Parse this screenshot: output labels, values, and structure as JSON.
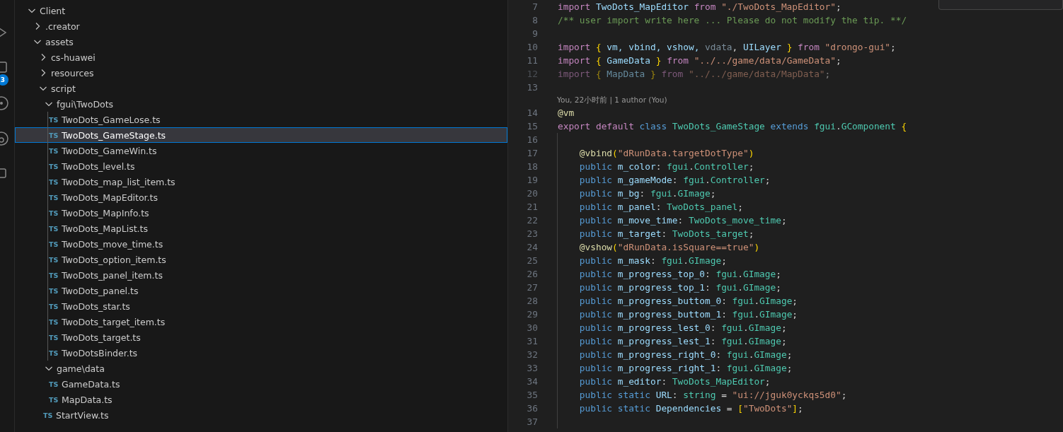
{
  "activity_bar": {
    "badge": "3"
  },
  "explorer": {
    "tree": [
      {
        "label": "Client",
        "kind": "folder",
        "expanded": true,
        "selected": false,
        "children": [
          {
            "label": ".creator",
            "kind": "folder",
            "expanded": false,
            "selected": false
          },
          {
            "label": "assets",
            "kind": "folder",
            "expanded": true,
            "selected": false,
            "children": [
              {
                "label": "cs-huawei",
                "kind": "folder",
                "expanded": false,
                "selected": false
              },
              {
                "label": "resources",
                "kind": "folder",
                "expanded": false,
                "selected": false
              },
              {
                "label": "script",
                "kind": "folder",
                "expanded": true,
                "selected": false,
                "children": [
                  {
                    "label": "fgui\\TwoDots",
                    "kind": "folder",
                    "expanded": true,
                    "selected": false,
                    "children": [
                      {
                        "label": "TwoDots_GameLose.ts",
                        "kind": "file",
                        "icon": "TS",
                        "selected": false
                      },
                      {
                        "label": "TwoDots_GameStage.ts",
                        "kind": "file",
                        "icon": "TS",
                        "selected": true
                      },
                      {
                        "label": "TwoDots_GameWin.ts",
                        "kind": "file",
                        "icon": "TS",
                        "selected": false
                      },
                      {
                        "label": "TwoDots_level.ts",
                        "kind": "file",
                        "icon": "TS",
                        "selected": false
                      },
                      {
                        "label": "TwoDots_map_list_item.ts",
                        "kind": "file",
                        "icon": "TS",
                        "selected": false
                      },
                      {
                        "label": "TwoDots_MapEditor.ts",
                        "kind": "file",
                        "icon": "TS",
                        "selected": false
                      },
                      {
                        "label": "TwoDots_MapInfo.ts",
                        "kind": "file",
                        "icon": "TS",
                        "selected": false
                      },
                      {
                        "label": "TwoDots_MapList.ts",
                        "kind": "file",
                        "icon": "TS",
                        "selected": false
                      },
                      {
                        "label": "TwoDots_move_time.ts",
                        "kind": "file",
                        "icon": "TS",
                        "selected": false
                      },
                      {
                        "label": "TwoDots_option_item.ts",
                        "kind": "file",
                        "icon": "TS",
                        "selected": false
                      },
                      {
                        "label": "TwoDots_panel_item.ts",
                        "kind": "file",
                        "icon": "TS",
                        "selected": false
                      },
                      {
                        "label": "TwoDots_panel.ts",
                        "kind": "file",
                        "icon": "TS",
                        "selected": false
                      },
                      {
                        "label": "TwoDots_star.ts",
                        "kind": "file",
                        "icon": "TS",
                        "selected": false
                      },
                      {
                        "label": "TwoDots_target_item.ts",
                        "kind": "file",
                        "icon": "TS",
                        "selected": false
                      },
                      {
                        "label": "TwoDots_target.ts",
                        "kind": "file",
                        "icon": "TS",
                        "selected": false
                      },
                      {
                        "label": "TwoDotsBinder.ts",
                        "kind": "file",
                        "icon": "TS",
                        "selected": false
                      }
                    ]
                  },
                  {
                    "label": "game\\data",
                    "kind": "folder",
                    "expanded": true,
                    "selected": false,
                    "children": [
                      {
                        "label": "GameData.ts",
                        "kind": "file",
                        "icon": "TS",
                        "selected": false
                      },
                      {
                        "label": "MapData.ts",
                        "kind": "file",
                        "icon": "TS",
                        "selected": false
                      }
                    ]
                  },
                  {
                    "label": "StartView.ts",
                    "kind": "file",
                    "icon": "TS",
                    "selected": false
                  }
                ]
              }
            ]
          }
        ]
      }
    ]
  },
  "editor": {
    "lines": [
      {
        "number": "7",
        "tokens": [
          {
            "kind": "keyword",
            "text": "import "
          },
          {
            "kind": "variable",
            "text": "TwoDots_MapEditor "
          },
          {
            "kind": "keyword",
            "text": "from "
          },
          {
            "kind": "string",
            "text": "\"./TwoDots_MapEditor\""
          },
          {
            "kind": "plain",
            "text": ";"
          }
        ]
      },
      {
        "number": "8",
        "tokens": [
          {
            "kind": "comment",
            "text": "/** user import write here ... Please do not modify the tip. **/"
          }
        ]
      },
      {
        "number": "9"
      },
      {
        "number": "10",
        "tokens": [
          {
            "kind": "keyword",
            "text": "import "
          },
          {
            "kind": "brace",
            "text": "{"
          },
          {
            "kind": "variable",
            "text": " vm, vbind, vshow, "
          },
          {
            "kind": "unused",
            "text": "vdata"
          },
          {
            "kind": "plain",
            "text": ", "
          },
          {
            "kind": "variable",
            "text": "UILayer "
          },
          {
            "kind": "brace",
            "text": "}"
          },
          {
            "kind": "keyword",
            "text": " from "
          },
          {
            "kind": "string",
            "text": "\"drongo-gui\""
          },
          {
            "kind": "plain",
            "text": ";"
          }
        ]
      },
      {
        "number": "11",
        "tokens": [
          {
            "kind": "keyword",
            "text": "import "
          },
          {
            "kind": "brace",
            "text": "{"
          },
          {
            "kind": "variable",
            "text": " GameData "
          },
          {
            "kind": "brace",
            "text": "}"
          },
          {
            "kind": "keyword",
            "text": " from "
          },
          {
            "kind": "string",
            "text": "\"../../game/data/GameData\""
          },
          {
            "kind": "plain",
            "text": ";"
          }
        ]
      },
      {
        "number": "12",
        "faded": true,
        "tokens": [
          {
            "kind": "keyword",
            "text": "import "
          },
          {
            "kind": "brace",
            "text": "{"
          },
          {
            "kind": "variable",
            "text": " MapData "
          },
          {
            "kind": "brace",
            "text": "}"
          },
          {
            "kind": "keyword",
            "text": " from "
          },
          {
            "kind": "string",
            "text": "\"../../game/data/MapData\""
          },
          {
            "kind": "plain",
            "text": ";"
          }
        ]
      },
      {
        "number": "13"
      },
      {
        "number": "14",
        "codelens": "You, 22小时前 | 1 author (You)",
        "tokens": [
          {
            "kind": "decorator",
            "text": "@vm"
          }
        ]
      },
      {
        "number": "15",
        "tokens": [
          {
            "kind": "keyword",
            "text": "export default "
          },
          {
            "kind": "storage",
            "text": "class "
          },
          {
            "kind": "type",
            "text": "TwoDots_GameStage "
          },
          {
            "kind": "storage",
            "text": "extends "
          },
          {
            "kind": "type",
            "text": "fgui"
          },
          {
            "kind": "plain",
            "text": "."
          },
          {
            "kind": "type",
            "text": "GComponent "
          },
          {
            "kind": "brace",
            "text": "{"
          }
        ]
      },
      {
        "number": "16",
        "guide": true
      },
      {
        "number": "17",
        "guide": true,
        "tokens": [
          {
            "kind": "decorator",
            "text": "    @vbind"
          },
          {
            "kind": "brace",
            "text": "("
          },
          {
            "kind": "string",
            "text": "\"dRunData.targetDotType\""
          },
          {
            "kind": "brace",
            "text": ")"
          }
        ]
      },
      {
        "number": "18",
        "guide": true,
        "tokens": [
          {
            "kind": "storage",
            "text": "    public"
          },
          {
            "kind": "variable",
            "text": " m_color"
          },
          {
            "kind": "plain",
            "text": ": "
          },
          {
            "kind": "type",
            "text": "fgui"
          },
          {
            "kind": "plain",
            "text": "."
          },
          {
            "kind": "type",
            "text": "Controller"
          },
          {
            "kind": "plain",
            "text": ";"
          }
        ]
      },
      {
        "number": "19",
        "guide": true,
        "tokens": [
          {
            "kind": "storage",
            "text": "    public"
          },
          {
            "kind": "variable",
            "text": " m_gameMode"
          },
          {
            "kind": "plain",
            "text": ": "
          },
          {
            "kind": "type",
            "text": "fgui"
          },
          {
            "kind": "plain",
            "text": "."
          },
          {
            "kind": "type",
            "text": "Controller"
          },
          {
            "kind": "plain",
            "text": ";"
          }
        ]
      },
      {
        "number": "20",
        "guide": true,
        "tokens": [
          {
            "kind": "storage",
            "text": "    public"
          },
          {
            "kind": "variable",
            "text": " m_bg"
          },
          {
            "kind": "plain",
            "text": ": "
          },
          {
            "kind": "type",
            "text": "fgui"
          },
          {
            "kind": "plain",
            "text": "."
          },
          {
            "kind": "type",
            "text": "GImage"
          },
          {
            "kind": "plain",
            "text": ";"
          }
        ]
      },
      {
        "number": "21",
        "guide": true,
        "tokens": [
          {
            "kind": "storage",
            "text": "    public"
          },
          {
            "kind": "variable",
            "text": " m_panel"
          },
          {
            "kind": "plain",
            "text": ": "
          },
          {
            "kind": "type",
            "text": "TwoDots_panel"
          },
          {
            "kind": "plain",
            "text": ";"
          }
        ]
      },
      {
        "number": "22",
        "guide": true,
        "tokens": [
          {
            "kind": "storage",
            "text": "    public"
          },
          {
            "kind": "variable",
            "text": " m_move_time"
          },
          {
            "kind": "plain",
            "text": ": "
          },
          {
            "kind": "type",
            "text": "TwoDots_move_time"
          },
          {
            "kind": "plain",
            "text": ";"
          }
        ]
      },
      {
        "number": "23",
        "guide": true,
        "tokens": [
          {
            "kind": "storage",
            "text": "    public"
          },
          {
            "kind": "variable",
            "text": " m_target"
          },
          {
            "kind": "plain",
            "text": ": "
          },
          {
            "kind": "type",
            "text": "TwoDots_target"
          },
          {
            "kind": "plain",
            "text": ";"
          }
        ]
      },
      {
        "number": "24",
        "guide": true,
        "tokens": [
          {
            "kind": "decorator",
            "text": "    @vshow"
          },
          {
            "kind": "brace",
            "text": "("
          },
          {
            "kind": "string",
            "text": "\"dRunData.isSquare==true\""
          },
          {
            "kind": "brace",
            "text": ")"
          }
        ]
      },
      {
        "number": "25",
        "guide": true,
        "tokens": [
          {
            "kind": "storage",
            "text": "    public"
          },
          {
            "kind": "variable",
            "text": " m_mask"
          },
          {
            "kind": "plain",
            "text": ": "
          },
          {
            "kind": "type",
            "text": "fgui"
          },
          {
            "kind": "plain",
            "text": "."
          },
          {
            "kind": "type",
            "text": "GImage"
          },
          {
            "kind": "plain",
            "text": ";"
          }
        ]
      },
      {
        "number": "26",
        "guide": true,
        "tokens": [
          {
            "kind": "storage",
            "text": "    public"
          },
          {
            "kind": "variable",
            "text": " m_progress_top_0"
          },
          {
            "kind": "plain",
            "text": ": "
          },
          {
            "kind": "type",
            "text": "fgui"
          },
          {
            "kind": "plain",
            "text": "."
          },
          {
            "kind": "type",
            "text": "GImage"
          },
          {
            "kind": "plain",
            "text": ";"
          }
        ]
      },
      {
        "number": "27",
        "guide": true,
        "tokens": [
          {
            "kind": "storage",
            "text": "    public"
          },
          {
            "kind": "variable",
            "text": " m_progress_top_1"
          },
          {
            "kind": "plain",
            "text": ": "
          },
          {
            "kind": "type",
            "text": "fgui"
          },
          {
            "kind": "plain",
            "text": "."
          },
          {
            "kind": "type",
            "text": "GImage"
          },
          {
            "kind": "plain",
            "text": ";"
          }
        ]
      },
      {
        "number": "28",
        "guide": true,
        "tokens": [
          {
            "kind": "storage",
            "text": "    public"
          },
          {
            "kind": "variable",
            "text": " m_progress_buttom_0"
          },
          {
            "kind": "plain",
            "text": ": "
          },
          {
            "kind": "type",
            "text": "fgui"
          },
          {
            "kind": "plain",
            "text": "."
          },
          {
            "kind": "type",
            "text": "GImage"
          },
          {
            "kind": "plain",
            "text": ";"
          }
        ]
      },
      {
        "number": "29",
        "guide": true,
        "tokens": [
          {
            "kind": "storage",
            "text": "    public"
          },
          {
            "kind": "variable",
            "text": " m_progress_buttom_1"
          },
          {
            "kind": "plain",
            "text": ": "
          },
          {
            "kind": "type",
            "text": "fgui"
          },
          {
            "kind": "plain",
            "text": "."
          },
          {
            "kind": "type",
            "text": "GImage"
          },
          {
            "kind": "plain",
            "text": ";"
          }
        ]
      },
      {
        "number": "30",
        "guide": true,
        "tokens": [
          {
            "kind": "storage",
            "text": "    public"
          },
          {
            "kind": "variable",
            "text": " m_progress_lest_0"
          },
          {
            "kind": "plain",
            "text": ": "
          },
          {
            "kind": "type",
            "text": "fgui"
          },
          {
            "kind": "plain",
            "text": "."
          },
          {
            "kind": "type",
            "text": "GImage"
          },
          {
            "kind": "plain",
            "text": ";"
          }
        ]
      },
      {
        "number": "31",
        "guide": true,
        "tokens": [
          {
            "kind": "storage",
            "text": "    public"
          },
          {
            "kind": "variable",
            "text": " m_progress_lest_1"
          },
          {
            "kind": "plain",
            "text": ": "
          },
          {
            "kind": "type",
            "text": "fgui"
          },
          {
            "kind": "plain",
            "text": "."
          },
          {
            "kind": "type",
            "text": "GImage"
          },
          {
            "kind": "plain",
            "text": ";"
          }
        ]
      },
      {
        "number": "32",
        "guide": true,
        "tokens": [
          {
            "kind": "storage",
            "text": "    public"
          },
          {
            "kind": "variable",
            "text": " m_progress_right_0"
          },
          {
            "kind": "plain",
            "text": ": "
          },
          {
            "kind": "type",
            "text": "fgui"
          },
          {
            "kind": "plain",
            "text": "."
          },
          {
            "kind": "type",
            "text": "GImage"
          },
          {
            "kind": "plain",
            "text": ";"
          }
        ]
      },
      {
        "number": "33",
        "guide": true,
        "tokens": [
          {
            "kind": "storage",
            "text": "    public"
          },
          {
            "kind": "variable",
            "text": " m_progress_right_1"
          },
          {
            "kind": "plain",
            "text": ": "
          },
          {
            "kind": "type",
            "text": "fgui"
          },
          {
            "kind": "plain",
            "text": "."
          },
          {
            "kind": "type",
            "text": "GImage"
          },
          {
            "kind": "plain",
            "text": ";"
          }
        ]
      },
      {
        "number": "34",
        "guide": true,
        "tokens": [
          {
            "kind": "storage",
            "text": "    public"
          },
          {
            "kind": "variable",
            "text": " m_editor"
          },
          {
            "kind": "plain",
            "text": ": "
          },
          {
            "kind": "type",
            "text": "TwoDots_MapEditor"
          },
          {
            "kind": "plain",
            "text": ";"
          }
        ]
      },
      {
        "number": "35",
        "guide": true,
        "tokens": [
          {
            "kind": "storage",
            "text": "    public static"
          },
          {
            "kind": "variable",
            "text": " URL"
          },
          {
            "kind": "plain",
            "text": ": "
          },
          {
            "kind": "type",
            "text": "string"
          },
          {
            "kind": "plain",
            "text": " = "
          },
          {
            "kind": "string",
            "text": "\"ui://jguk0yckqs5d0\""
          },
          {
            "kind": "plain",
            "text": ";"
          }
        ]
      },
      {
        "number": "36",
        "guide": true,
        "tokens": [
          {
            "kind": "storage",
            "text": "    public static"
          },
          {
            "kind": "variable",
            "text": " Dependencies"
          },
          {
            "kind": "plain",
            "text": " = "
          },
          {
            "kind": "brace",
            "text": "["
          },
          {
            "kind": "string",
            "text": "\"TwoDots\""
          },
          {
            "kind": "brace",
            "text": "]"
          },
          {
            "kind": "plain",
            "text": ";"
          }
        ]
      },
      {
        "number": "37",
        "guide": true
      }
    ]
  }
}
